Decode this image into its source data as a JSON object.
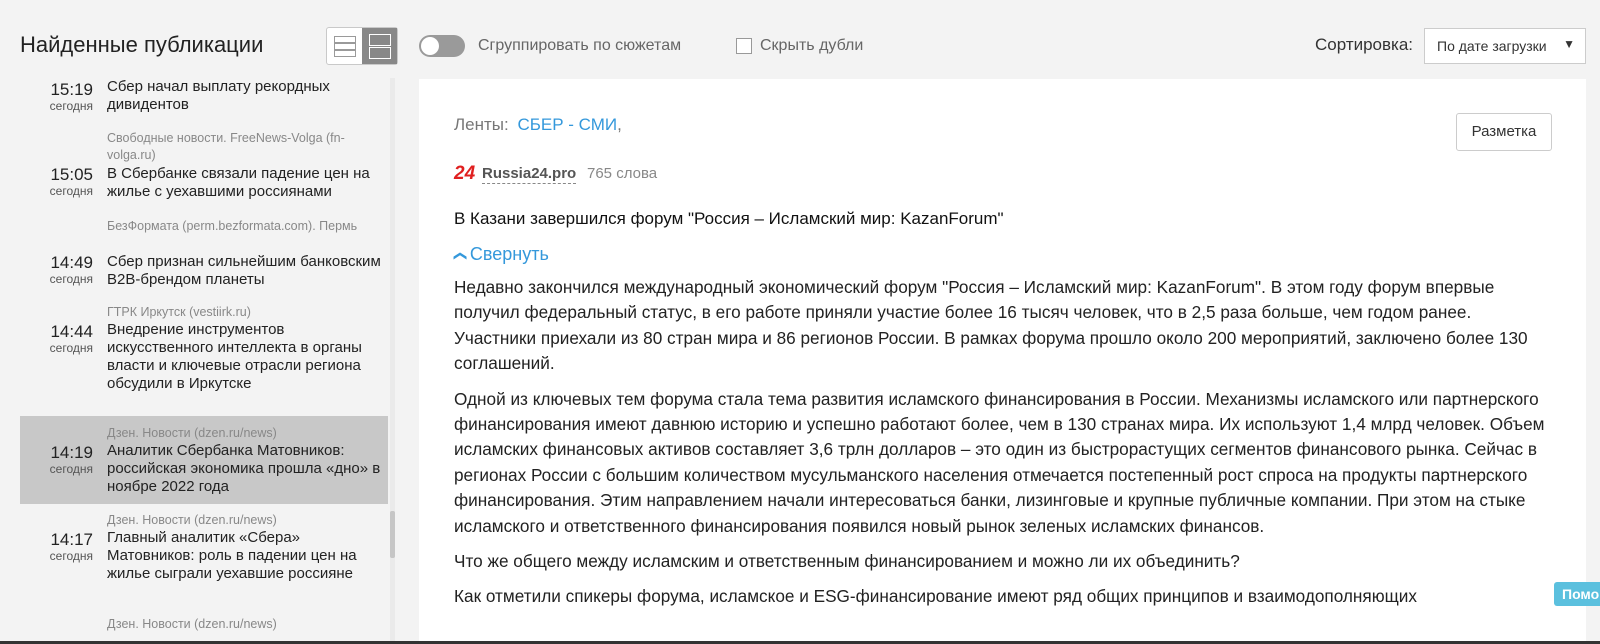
{
  "toolbar": {
    "title": "Найденные публикации",
    "group_label": "Сгруппировать по сюжетам",
    "hide_duplicates_label": "Скрыть дубли",
    "sort_label": "Сортировка:",
    "sort_value": "По дате загрузки",
    "group_toggle_on": false,
    "hide_duplicates_checked": false
  },
  "news": [
    {
      "time": "15:19",
      "day": "сегодня",
      "source": "",
      "title": "Сбер начал выплату рекордных дивидентов",
      "selected": false
    },
    {
      "time": "15:05",
      "day": "сегодня",
      "source": "Свободные новости. FreeNews-Volga (fn-volga.ru)",
      "title": "В Сбербанке связали падение цен на жилье с уехавшими россиянами",
      "selected": false
    },
    {
      "time": "14:49",
      "day": "сегодня",
      "source": "БезФормата (perm.bezformata.com). Пермь",
      "title": "Сбер признан сильнейшим банковским B2B-брендом планеты",
      "selected": false
    },
    {
      "time": "14:44",
      "day": "сегодня",
      "source": "ГТРК Иркутск (vestiirk.ru)",
      "title": "Внедрение инструментов искусственного интеллекта в органы власти и ключевые отрасли региона обсудили в Иркутске",
      "selected": false
    },
    {
      "time": "14:19",
      "day": "сегодня",
      "source": "Дзен. Новости (dzen.ru/news)",
      "title": "Аналитик Сбербанка Матовников: российская экономика прошла «дно» в ноябре 2022 года",
      "selected": true
    },
    {
      "time": "14:17",
      "day": "сегодня",
      "source": "Дзен. Новости (dzen.ru/news)",
      "title": "Главный аналитик «Сбера» Матовников: роль в падении цен на жилье сыграли уехавшие россияне",
      "selected": false
    },
    {
      "time": "",
      "day": "",
      "source": "Дзен. Новости (dzen.ru/news)",
      "title": "",
      "selected": false
    }
  ],
  "article": {
    "feeds_label": "Ленты:",
    "feed_link": "СБЕР - СМИ",
    "feed_sep": ",",
    "markup_button": "Разметка",
    "source_logo": "24",
    "source_name": "Russia24.pro",
    "word_count": "765 слова",
    "title": "В Казани завершился форум \"Россия – Исламский мир: KazanForum\"",
    "collapse_label": "Свернуть",
    "paragraphs": [
      "Недавно закончился международный экономический форум \"Россия – Исламский мир: KazanForum\". В этом году форум впервые получил федеральный статус, в его работе приняли участие более 16 тысяч человек, что в 2,5 раза больше, чем годом ранее. Участники приехали из 80 стран мира и 86 регионов России. В рамках форума прошло около 200 мероприятий, заключено более 130 соглашений.",
      "Одной из ключевых тем форума стала тема развития исламского финансирования в России. Механизмы исламского или партнерского финансирования имеют давнюю историю и успешно работают более, чем в 130 странах мира. Их используют 1,4 млрд человек. Объем исламских финансовых активов составляет 3,6 трлн долларов – это один из быстрорастущих сегментов финансового рынка. Сейчас в регионах России с большим количеством мусульманского населения отмечается постепенный рост спроса на продукты партнерского финансирования. Этим направлением начали интересоваться банки, лизинговые и крупные публичные компании. При этом на стыке исламского и ответственного финансирования появился новый рынок зеленых исламских финансов.",
      "Что же общего между исламским и ответственным финансированием и можно ли их объединить?",
      "Как отметили спикеры форума, исламское и ESG-финансирование имеют ряд общих принципов и взаимодополняющих"
    ]
  },
  "help_label": "Помощь",
  "colors": {
    "accent": "#3498db",
    "logo_red": "#e02020",
    "selected_row": "#c8c8c8"
  }
}
